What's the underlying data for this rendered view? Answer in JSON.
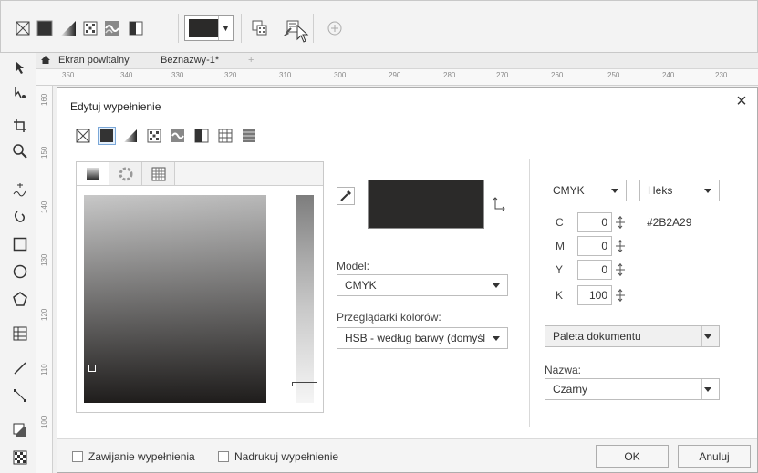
{
  "tabs": {
    "welcome": "Ekran powitalny",
    "document": "Beznazwy-1*"
  },
  "ruler_h": [
    "350",
    "340",
    "330",
    "320",
    "310",
    "300",
    "290",
    "280",
    "270",
    "260",
    "250",
    "240",
    "230"
  ],
  "ruler_v": [
    "160",
    "150",
    "140",
    "130",
    "120",
    "110",
    "100"
  ],
  "toolbar": {
    "current_fill_color": "#2b2a29"
  },
  "dialog": {
    "title": "Edytuj wypełnienie",
    "model_label": "Model:",
    "model_value": "CMYK",
    "viewers_label": "Przeglądarki kolorów:",
    "viewers_value": "HSB - według barwy (domyśl",
    "color_model_select": "CMYK",
    "hex_select": "Heks",
    "hex_value": "#2B2A29",
    "cmyk": {
      "c_label": "C",
      "c_value": "0",
      "m_label": "M",
      "m_value": "0",
      "y_label": "Y",
      "y_value": "0",
      "k_label": "K",
      "k_value": "100"
    },
    "palette_value": "Paleta dokumentu",
    "name_label": "Nazwa:",
    "name_value": "Czarny",
    "wrap_fill_label": "Zawijanie wypełnienia",
    "overprint_label": "Nadrukuj wypełnienie",
    "ok_label": "OK",
    "cancel_label": "Anuluj",
    "swatch_color": "#2b2a29"
  }
}
